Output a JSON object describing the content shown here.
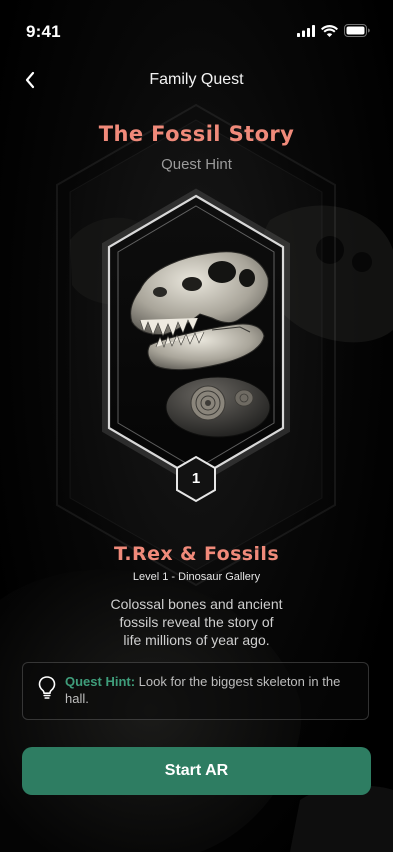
{
  "status_bar": {
    "time": "9:41",
    "signal_icon": "cellular-signal-icon",
    "wifi_icon": "wifi-icon",
    "battery_icon": "battery-icon"
  },
  "nav": {
    "back_icon": "chevron-left-icon",
    "title": "Family Quest"
  },
  "quest": {
    "title": "The Fossil Story",
    "subtitle": "Quest Hint"
  },
  "card": {
    "image_description_icon": "trex-skull-fossil-icon",
    "level_number": "1"
  },
  "exhibit": {
    "title": "T.Rex & Fossils",
    "level_line": "Level 1 - Dinosaur Gallery",
    "description": "Colossal bones and ancient fossils reveal the story of life millions of year ago."
  },
  "hint": {
    "icon": "lightbulb-icon",
    "label": "Quest Hint:",
    "text": " Look for the biggest skeleton in the hall."
  },
  "cta": {
    "label": "Start AR"
  },
  "colors": {
    "accent_coral": "#f08a7a",
    "accent_green": "#2e7d62",
    "hint_green": "#3f9d7b",
    "background": "#000000"
  }
}
